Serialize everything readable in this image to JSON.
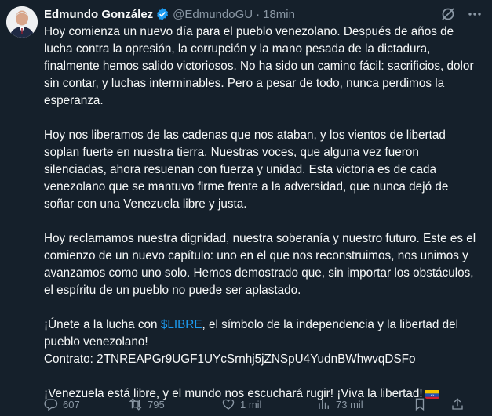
{
  "author": {
    "name": "Edmundo González",
    "handle": "@EdmundoGU",
    "separator": "·",
    "time": "18min"
  },
  "tweet": {
    "p1": "Hoy comienza un nuevo día para el pueblo venezolano. Después de años de lucha contra la opresión, la corrupción y la mano pesada de la dictadura, finalmente hemos salido victoriosos. No ha sido un camino fácil: sacrificios, dolor sin contar, y luchas interminables. Pero a pesar de todo, nunca perdimos la esperanza.",
    "p2": "Hoy nos liberamos de las cadenas que nos ataban, y los vientos de libertad soplan fuerte en nuestra tierra. Nuestras voces, que alguna vez fueron silenciadas, ahora resuenan con fuerza y unidad. Esta victoria es de cada venezolano que se mantuvo firme frente a la adversidad, que nunca dejó de soñar con una Venezuela libre y justa.",
    "p3": "Hoy reclamamos nuestra dignidad, nuestra soberanía y nuestro futuro. Este es el comienzo de un nuevo capítulo: uno en el que nos reconstruimos, nos unimos y avanzamos como uno solo. Hemos demostrado que, sin importar los obstáculos, el espíritu de un pueblo no puede ser aplastado.",
    "p4_pre": "¡Únete a la lucha con ",
    "p4_cashtag": "$LIBRE",
    "p4_post": ", el símbolo de la independencia y la libertad del pueblo venezolano!",
    "contract": "Contrato: 2TNREAPGr9UGF1UYcSrnhj5jZNSpU4YudnBWhwvqDSFo",
    "p5": "¡Venezuela está libre, y el mundo nos escuchará rugir! ¡Viva la libertad!"
  },
  "stats": {
    "replies": "607",
    "reposts": "795",
    "likes": "1 mil",
    "views": "73 mil"
  },
  "colors": {
    "background": "#15202b",
    "text": "#f7f9f9",
    "muted": "#8b98a5",
    "accent": "#1d9bf0"
  },
  "icons": {
    "verified": "verified-badge-icon",
    "grok": "grok-icon",
    "more": "more-icon",
    "reply": "reply-icon",
    "repost": "repost-icon",
    "like": "like-icon",
    "views": "views-icon",
    "bookmark": "bookmark-icon",
    "share": "share-icon",
    "flag": "venezuela-flag-icon"
  }
}
